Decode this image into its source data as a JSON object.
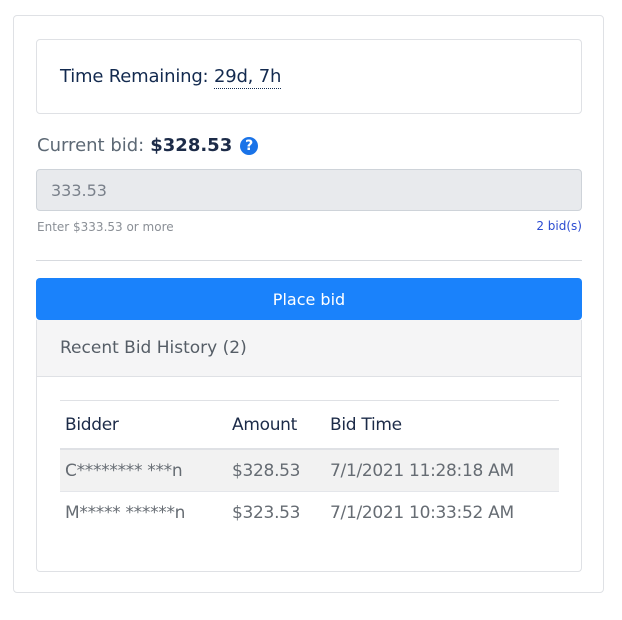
{
  "time": {
    "label": "Time Remaining:",
    "value": "29d, 7h"
  },
  "current_bid": {
    "label": "Current bid:",
    "amount": "$328.53",
    "help_icon": "question-circle-icon",
    "help_glyph": "?"
  },
  "bid_input": {
    "value": "333.53"
  },
  "hint": "Enter $333.53 or more",
  "bids_link": "2 bid(s)",
  "place_bid_label": "Place bid",
  "history": {
    "title": "Recent Bid History (2)",
    "columns": [
      "Bidder",
      "Amount",
      "Bid Time"
    ],
    "rows": [
      {
        "bidder": "C******** ***n",
        "amount": "$328.53",
        "time": "7/1/2021 11:28:18 AM"
      },
      {
        "bidder": "M***** ******n",
        "amount": "$323.53",
        "time": "7/1/2021 10:33:52 AM"
      }
    ]
  },
  "colors": {
    "primary": "#1a82fb",
    "help_icon": "#1a73e8",
    "link": "#2b4bd1"
  }
}
